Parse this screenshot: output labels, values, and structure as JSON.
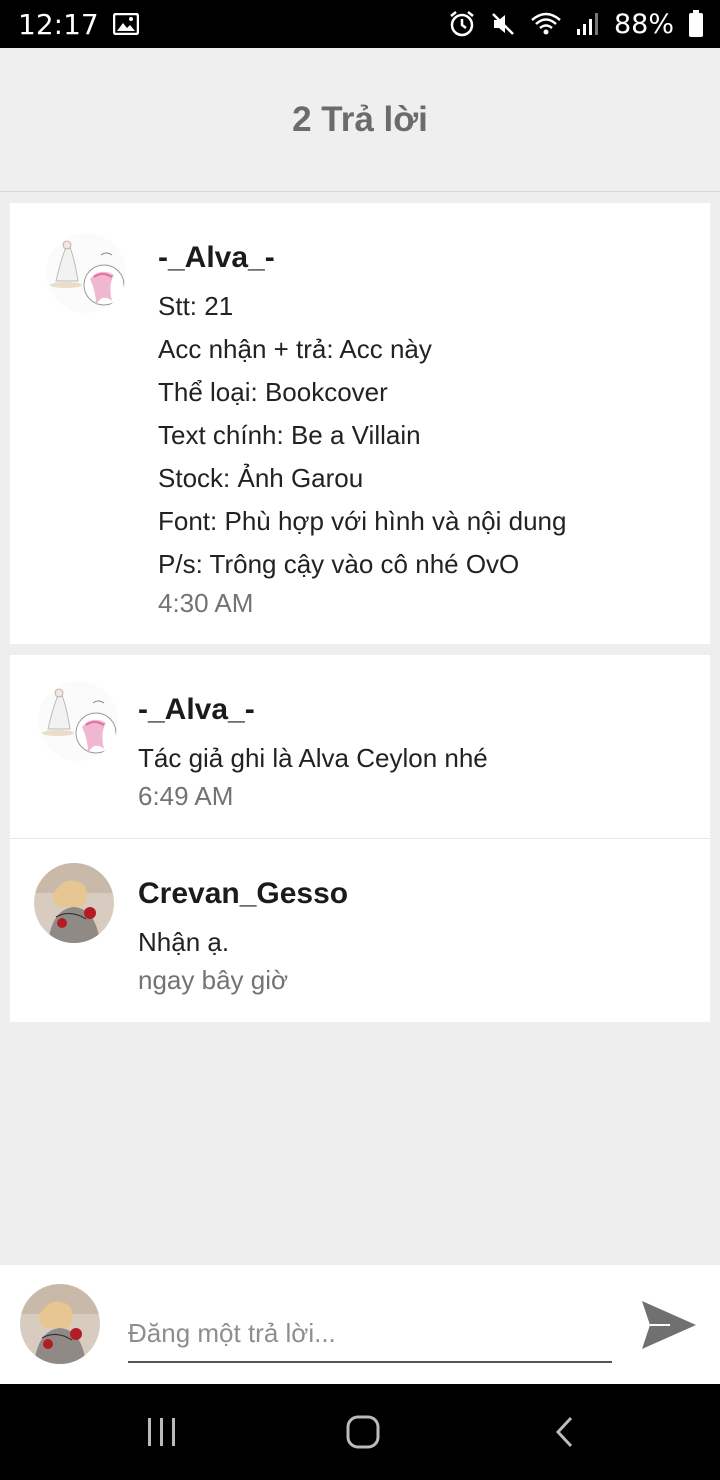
{
  "status_bar": {
    "time": "12:17",
    "battery": "88%",
    "icons": [
      "image-icon",
      "alarm-icon",
      "mute-icon",
      "wifi-icon",
      "signal-icon",
      "battery-icon"
    ]
  },
  "header": {
    "title": "2 Trả lời"
  },
  "main_comment": {
    "author": "-_Alva_-",
    "lines": [
      "Stt: 21",
      "Acc nhận + trả: Acc này",
      "Thể loại: Bookcover",
      "Text chính: Be a Villain",
      "Stock: Ảnh Garou",
      "Font: Phù hợp với hình và nội dung",
      "P/s: Trông cậy vào cô nhé OvO"
    ],
    "time": "4:30 AM"
  },
  "replies": [
    {
      "author": "-_Alva_-",
      "text": "Tác giả ghi là Alva Ceylon nhé",
      "time": "6:49 AM"
    },
    {
      "author": "Crevan_Gesso",
      "text": "Nhận ạ.",
      "time": "ngay bây giờ"
    }
  ],
  "compose": {
    "placeholder": "Đăng một trả lời..."
  },
  "colors": {
    "header_bg": "#efefef",
    "page_bg": "#eeeeee",
    "title_text": "#6b6b6b",
    "time_text": "#737373",
    "send_icon": "#707070"
  }
}
